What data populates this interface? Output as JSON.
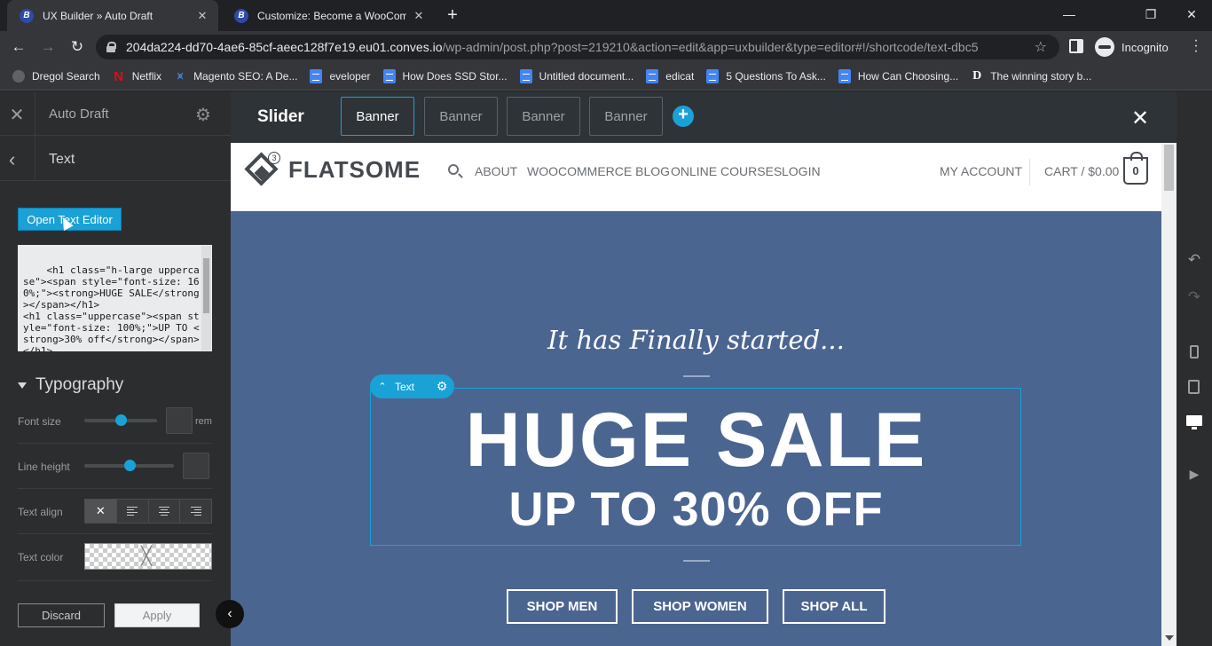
{
  "browser": {
    "tabs": [
      {
        "title": "UX Builder » Auto Draft",
        "active": true
      },
      {
        "title": "Customize: Become a WooComm",
        "active": false
      }
    ],
    "url_host": "204da224-dd70-4ae6-85cf-aeec128f7e19.eu01.conves.io",
    "url_path": "/wp-admin/post.php?post=219210&action=edit&app=uxbuilder&type=editor#!/shortcode/text-dbc5",
    "profile_label": "Incognito",
    "bookmarks": [
      {
        "label": "Dregol Search",
        "icon": "globe-icon"
      },
      {
        "label": "Netflix",
        "icon": "netflix-icon"
      },
      {
        "label": "Magento SEO: A De...",
        "icon": "magento-icon"
      },
      {
        "label": "eveloper",
        "icon": "docs-icon"
      },
      {
        "label": "How Does SSD Stor...",
        "icon": "docs-icon"
      },
      {
        "label": "Untitled document...",
        "icon": "docs-icon"
      },
      {
        "label": "edicat",
        "icon": "docs-icon"
      },
      {
        "label": "5 Questions To Ask...",
        "icon": "docs-icon"
      },
      {
        "label": "How Can Choosing...",
        "icon": "docs-icon"
      },
      {
        "label": "The winning story b...",
        "icon": "d-icon"
      }
    ]
  },
  "panel": {
    "title": "Auto Draft",
    "section": "Text",
    "open_editor_label": "Open Text Editor",
    "code": "<h1 class=\"h-large uppercase\"><span style=\"font-size: 160%;\"><strong>HUGE SALE</strong></span></h1>\n<h1 class=\"uppercase\"><span style=\"font-size: 100%;\">UP TO <strong>30% off</strong></span></h1>",
    "typography_label": "Typography",
    "font_size_label": "Font size",
    "font_size_unit": "rem",
    "line_height_label": "Line height",
    "text_align_label": "Text align",
    "text_color_label": "Text color",
    "discard_label": "Discard",
    "apply_label": "Apply"
  },
  "builder": {
    "slider_label": "Slider",
    "banners": [
      "Banner",
      "Banner",
      "Banner",
      "Banner"
    ],
    "add_label": "+"
  },
  "site": {
    "logo_text": "FLATSOME",
    "logo_badge": "3",
    "nav": [
      "ABOUT",
      "WOOCOMMERCE BLOG",
      "ONLINE COURSES",
      "LOGIN"
    ],
    "account_label": "MY ACCOUNT",
    "cart_label": "CART / $0.00",
    "cart_count": "0",
    "tagline": "It has Finally started...",
    "text_element_label": "Text",
    "headline": "HUGE SALE",
    "subheadline": "UP TO 30% OFF",
    "buttons": [
      "SHOP MEN",
      "SHOP WOMEN",
      "SHOP ALL"
    ]
  },
  "colors": {
    "accent": "#1aa1d6",
    "banner_bg": "#4b6591",
    "panel_bg": "#2b2d2f"
  }
}
